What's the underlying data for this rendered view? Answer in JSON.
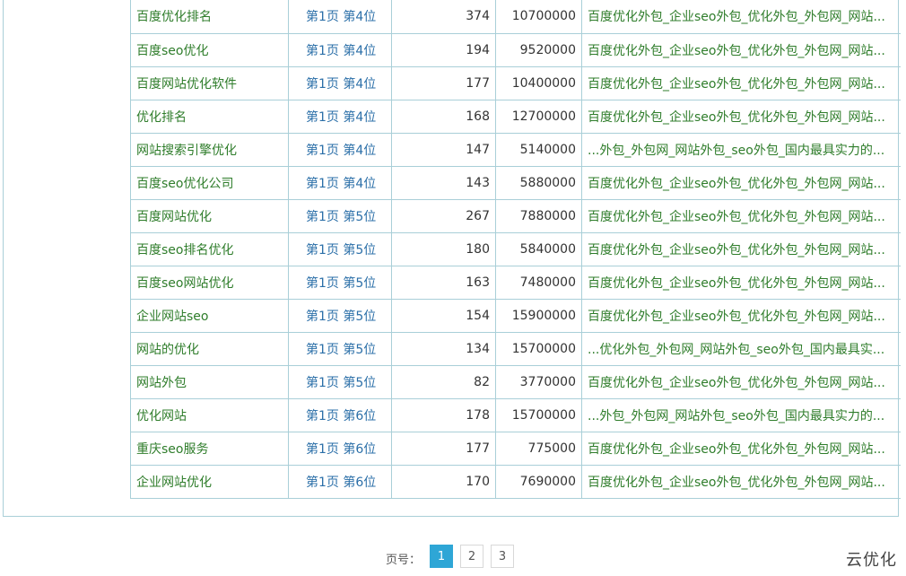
{
  "rows": [
    {
      "keyword": "百度优化排名",
      "rank": "第1页 第4位",
      "index": "374",
      "volume": "10700000",
      "title": "百度优化外包_企业seo外包_优化外包_外包网_网站..."
    },
    {
      "keyword": "百度seo优化",
      "rank": "第1页 第4位",
      "index": "194",
      "volume": "9520000",
      "title": "百度优化外包_企业seo外包_优化外包_外包网_网站..."
    },
    {
      "keyword": "百度网站优化软件",
      "rank": "第1页 第4位",
      "index": "177",
      "volume": "10400000",
      "title": "百度优化外包_企业seo外包_优化外包_外包网_网站..."
    },
    {
      "keyword": "优化排名",
      "rank": "第1页 第4位",
      "index": "168",
      "volume": "12700000",
      "title": "百度优化外包_企业seo外包_优化外包_外包网_网站..."
    },
    {
      "keyword": "网站搜索引擎优化",
      "rank": "第1页 第4位",
      "index": "147",
      "volume": "5140000",
      "title": "...外包_外包网_网站外包_seo外包_国内最具实力的..."
    },
    {
      "keyword": "百度seo优化公司",
      "rank": "第1页 第4位",
      "index": "143",
      "volume": "5880000",
      "title": "百度优化外包_企业seo外包_优化外包_外包网_网站..."
    },
    {
      "keyword": "百度网站优化",
      "rank": "第1页 第5位",
      "index": "267",
      "volume": "7880000",
      "title": "百度优化外包_企业seo外包_优化外包_外包网_网站..."
    },
    {
      "keyword": "百度seo排名优化",
      "rank": "第1页 第5位",
      "index": "180",
      "volume": "5840000",
      "title": "百度优化外包_企业seo外包_优化外包_外包网_网站..."
    },
    {
      "keyword": "百度seo网站优化",
      "rank": "第1页 第5位",
      "index": "163",
      "volume": "7480000",
      "title": "百度优化外包_企业seo外包_优化外包_外包网_网站..."
    },
    {
      "keyword": "企业网站seo",
      "rank": "第1页 第5位",
      "index": "154",
      "volume": "15900000",
      "title": "百度优化外包_企业seo外包_优化外包_外包网_网站..."
    },
    {
      "keyword": "网站的优化",
      "rank": "第1页 第5位",
      "index": "134",
      "volume": "15700000",
      "title": "...优化外包_外包网_网站外包_seo外包_国内最具实..."
    },
    {
      "keyword": "网站外包",
      "rank": "第1页 第5位",
      "index": "82",
      "volume": "3770000",
      "title": "百度优化外包_企业seo外包_优化外包_外包网_网站..."
    },
    {
      "keyword": "优化网站",
      "rank": "第1页 第6位",
      "index": "178",
      "volume": "15700000",
      "title": "...外包_外包网_网站外包_seo外包_国内最具实力的..."
    },
    {
      "keyword": "重庆seo服务",
      "rank": "第1页 第6位",
      "index": "177",
      "volume": "775000",
      "title": "百度优化外包_企业seo外包_优化外包_外包网_网站..."
    },
    {
      "keyword": "企业网站优化",
      "rank": "第1页 第6位",
      "index": "170",
      "volume": "7690000",
      "title": "百度优化外包_企业seo外包_优化外包_外包网_网站..."
    }
  ],
  "pager": {
    "label": "页号：",
    "pages": [
      "1",
      "2",
      "3"
    ],
    "current": "1"
  },
  "watermark": "云优化",
  "colors": {
    "border": "#a9cfd8",
    "keyword_text": "#2f7d2b",
    "rank_text": "#2b6fa8",
    "active_page": "#2ea6d6"
  }
}
